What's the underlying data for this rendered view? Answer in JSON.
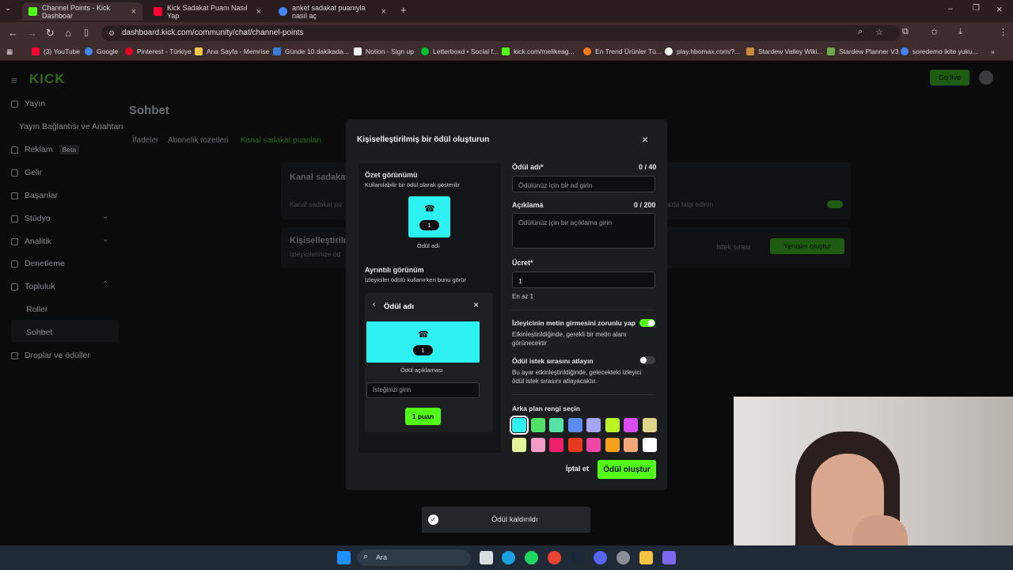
{
  "browser": {
    "tabs": [
      {
        "title": "Channel Points - Kick Dashboar",
        "color": "#53fc18"
      },
      {
        "title": "Kick Sadakat Puanı Nasıl Yap",
        "color": "#ff0033"
      },
      {
        "title": "anket sadakat puanıyla nasıl aç",
        "color": "#4285f4"
      }
    ],
    "url": "dashboard.kick.com/community/chat/channel-points",
    "bookmarks": [
      "(3) YouTube",
      "Google",
      "Pinterest - Türkiye",
      "Ana Sayfa - Memrise",
      "Günde 10 dakikada...",
      "Notion - Sign up",
      "Letterboxd • Social f...",
      "kick.com/melikeag...",
      "En Trend Ürünler Tü...",
      "play.hbomax.com/?...",
      "Stardew Valley Wiki...",
      "Stardew Planner V3",
      "soredemo ikite yuku..."
    ]
  },
  "dashboard": {
    "logo": "KICK",
    "live_button": "Go live",
    "sidebar": [
      {
        "label": "Yayın"
      },
      {
        "label": "Yayın Bağlantısı ve Anahtarı",
        "sub": true
      },
      {
        "label": "Reklam",
        "badge": "Beta"
      },
      {
        "label": "Gelir"
      },
      {
        "label": "Başarılar"
      },
      {
        "label": "Stüdyo"
      },
      {
        "label": "Analitik"
      },
      {
        "label": "Denetleme"
      },
      {
        "label": "Topluluk"
      },
      {
        "label": "Roller",
        "sub": true
      },
      {
        "label": "Sohbet",
        "sub": true
      },
      {
        "label": "Droplar ve ödüller"
      }
    ],
    "page_title": "Sohbet",
    "tabs": [
      "İfadeler",
      "Abonelik rozetleri",
      "Kanal sadakat puanları"
    ],
    "card1_title": "Kanal sadakat",
    "card1_text": "Kanal sadakat pu",
    "card1_right": "azla bilgi edinin",
    "card2_title": "Kişiselleştirilm",
    "card2_text": "İzleyicilerinize öd",
    "queue_label": "İstek sırası",
    "new_button": "Yenisini oluştur"
  },
  "modal": {
    "title": "Kişiselleştirilmiş bir ödül oluşturun",
    "summary_title": "Özet görünümü",
    "summary_sub": "Kullanılabilir bir ödül olarak gösterilir",
    "reward_count": "1",
    "reward_name_placeholder": "Ödül adı",
    "detail_title": "Ayrıntılı görünüm",
    "detail_sub": "İzleyiciler ödülü kullanırken bunu görür",
    "detail_header": "Ödül adı",
    "detail_desc": "Ödül açıklaması",
    "detail_input_placeholder": "İsteğinizi girin",
    "detail_button": "1 puan",
    "name_label": "Ödül adı*",
    "name_counter": "0 / 40",
    "name_placeholder": "Ödülünüz için bir ad girin",
    "desc_label": "Açıklama",
    "desc_counter": "0 / 200",
    "desc_placeholder": "Ödülünüz için bir açıklama girin",
    "cost_label": "Ücret*",
    "cost_value": "1",
    "cost_hint": "En az 1",
    "toggle1_label": "İzleyicinin metin girmesini zorunlu yap",
    "toggle1_desc": "Etkinleştirildiğinde, gerekli bir metin alanı görünecektir",
    "toggle2_label": "Ödül istek sırasını atlayın",
    "toggle2_desc": "Bu ayar etkinleştirildiğinde, gelecekteki izleyici ödül istek sırasını atlayacaktır.",
    "color_label": "Arka plan rengi seçin",
    "colors": [
      "#2ef2f2",
      "#53e068",
      "#56e3a8",
      "#5b8cf0",
      "#a7a4f5",
      "#b9f425",
      "#d94df0",
      "#e3d58e",
      "#e3f59b",
      "#f29ac8",
      "#f0206a",
      "#e8381e",
      "#f046a8",
      "#f59f1a",
      "#f4a77a",
      "#ffffff"
    ],
    "cancel": "İptal et",
    "create": "Ödül oluştur"
  },
  "toast": "Ödül kaldırıldı",
  "taskbar": {
    "search": "Ara"
  }
}
